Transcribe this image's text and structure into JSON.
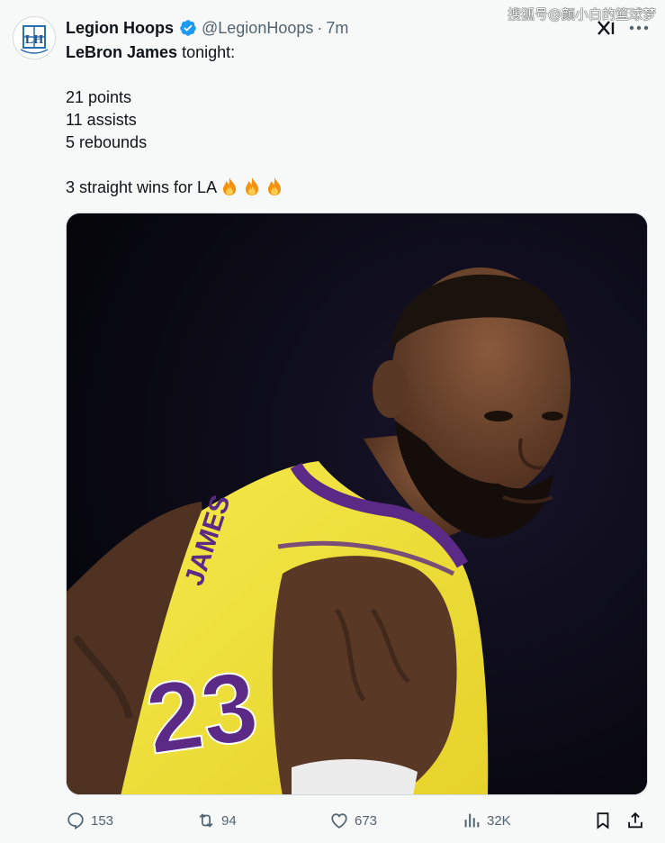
{
  "tweet": {
    "display_name": "Legion Hoops",
    "handle": "@LegionHoops",
    "separator": "·",
    "time": "7m",
    "avatar_initials": "LH",
    "watermark": "搜狐号@颜小白的篮球梦",
    "text": {
      "line1_bold": "LeBron James",
      "line1_rest": " tonight:",
      "stat_points": "21 points",
      "stat_assists": "11 assists",
      "stat_rebounds": "5 rebounds",
      "wins_line": "3 straight wins for LA"
    },
    "jersey_text": "JAMES",
    "jersey_number": "23",
    "icons": {
      "verified": "verified-badge-icon",
      "grok": "grok-icon",
      "more": "more-icon",
      "emoji": "fire-emoji-icon"
    },
    "accent_color": "#1d9bf0"
  },
  "actions": {
    "replies": "153",
    "retweets": "94",
    "likes": "673",
    "views": "32K"
  }
}
